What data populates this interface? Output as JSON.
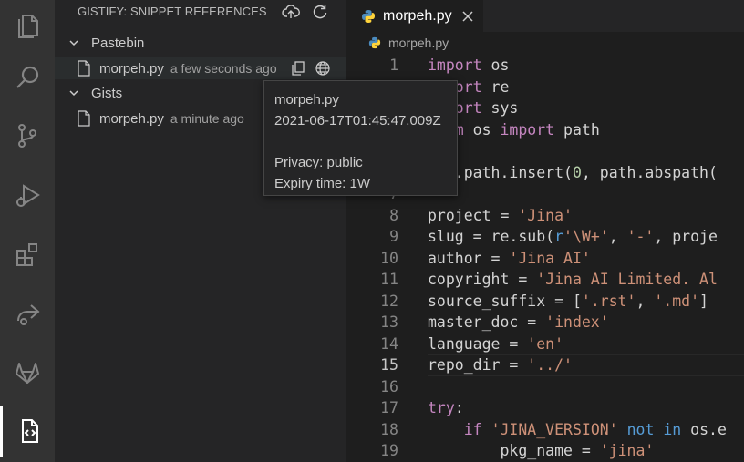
{
  "activity_bar": {
    "items": [
      {
        "icon": "files-icon"
      },
      {
        "icon": "search-icon"
      },
      {
        "icon": "source-control-icon"
      },
      {
        "icon": "run-debug-icon"
      },
      {
        "icon": "extensions-icon"
      },
      {
        "icon": "live-share-icon"
      },
      {
        "icon": "gitlab-icon"
      },
      {
        "icon": "gistify-icon",
        "active": true
      }
    ]
  },
  "sidebar": {
    "title": "GISTIFY: SNIPPET REFERENCES",
    "actions": [
      "cloud-upload-icon",
      "refresh-icon"
    ],
    "sections": [
      {
        "label": "Pastebin",
        "items": [
          {
            "name": "morpeh.py",
            "description": "a few seconds ago",
            "actions": [
              "copy-icon",
              "globe-icon"
            ]
          }
        ]
      },
      {
        "label": "Gists",
        "items": [
          {
            "name": "morpeh.py",
            "description": "a minute ago"
          }
        ]
      }
    ]
  },
  "tooltip": {
    "name": "morpeh.py",
    "timestamp": "2021-06-17T01:45:47.009Z",
    "privacy": "Privacy: public",
    "expiry": "Expiry time: 1W"
  },
  "editor": {
    "tab_label": "morpeh.py",
    "breadcrumb": "morpeh.py",
    "current_line": 15,
    "line_numbers": [
      "1",
      "2",
      "3",
      "4",
      "5",
      "6",
      "7",
      "8",
      "9",
      "10",
      "11",
      "12",
      "13",
      "14",
      "15",
      "16",
      "17",
      "18",
      "19"
    ],
    "lines": [
      {
        "tokens": [
          {
            "t": "import",
            "c": "kw"
          },
          {
            "t": " os"
          }
        ]
      },
      {
        "tokens": [
          {
            "t": "import",
            "c": "kw"
          },
          {
            "t": " re"
          }
        ]
      },
      {
        "tokens": [
          {
            "t": "import",
            "c": "kw"
          },
          {
            "t": " sys"
          }
        ]
      },
      {
        "tokens": [
          {
            "t": "from",
            "c": "kw"
          },
          {
            "t": " os "
          },
          {
            "t": "import",
            "c": "kw"
          },
          {
            "t": " path"
          }
        ]
      },
      {
        "tokens": []
      },
      {
        "tokens": [
          {
            "t": "sys.path.insert(",
            "c": ""
          },
          {
            "t": "0",
            "c": "num"
          },
          {
            "t": ", path.abspath(",
            "c": ""
          }
        ]
      },
      {
        "tokens": []
      },
      {
        "tokens": [
          {
            "t": "project = "
          },
          {
            "t": "'Jina'",
            "c": "str"
          }
        ]
      },
      {
        "tokens": [
          {
            "t": "slug = re.sub("
          },
          {
            "t": "r",
            "c": "kw2"
          },
          {
            "t": "'\\W+'",
            "c": "str"
          },
          {
            "t": ", "
          },
          {
            "t": "'-'",
            "c": "str"
          },
          {
            "t": ", proje"
          }
        ]
      },
      {
        "tokens": [
          {
            "t": "author = "
          },
          {
            "t": "'Jina AI'",
            "c": "str"
          }
        ]
      },
      {
        "tokens": [
          {
            "t": "copyright = "
          },
          {
            "t": "'Jina AI Limited. Al",
            "c": "str"
          }
        ]
      },
      {
        "tokens": [
          {
            "t": "source_suffix = ["
          },
          {
            "t": "'.rst'",
            "c": "str"
          },
          {
            "t": ", "
          },
          {
            "t": "'.md'",
            "c": "str"
          },
          {
            "t": "]"
          }
        ]
      },
      {
        "tokens": [
          {
            "t": "master_doc = "
          },
          {
            "t": "'index'",
            "c": "str"
          }
        ]
      },
      {
        "tokens": [
          {
            "t": "language = "
          },
          {
            "t": "'en'",
            "c": "str"
          }
        ]
      },
      {
        "tokens": [
          {
            "t": "repo_dir = "
          },
          {
            "t": "'../'",
            "c": "str"
          }
        ]
      },
      {
        "tokens": []
      },
      {
        "tokens": [
          {
            "t": "try",
            "c": "kw"
          },
          {
            "t": ":"
          }
        ]
      },
      {
        "tokens": [
          {
            "t": "    "
          },
          {
            "t": "if",
            "c": "kw"
          },
          {
            "t": " "
          },
          {
            "t": "'JINA_VERSION'",
            "c": "str"
          },
          {
            "t": " "
          },
          {
            "t": "not",
            "c": "kw2"
          },
          {
            "t": " "
          },
          {
            "t": "in",
            "c": "kw2"
          },
          {
            "t": " os.e"
          }
        ]
      },
      {
        "tokens": [
          {
            "t": "        pkg_name = "
          },
          {
            "t": "'jina'",
            "c": "str"
          }
        ]
      }
    ]
  }
}
